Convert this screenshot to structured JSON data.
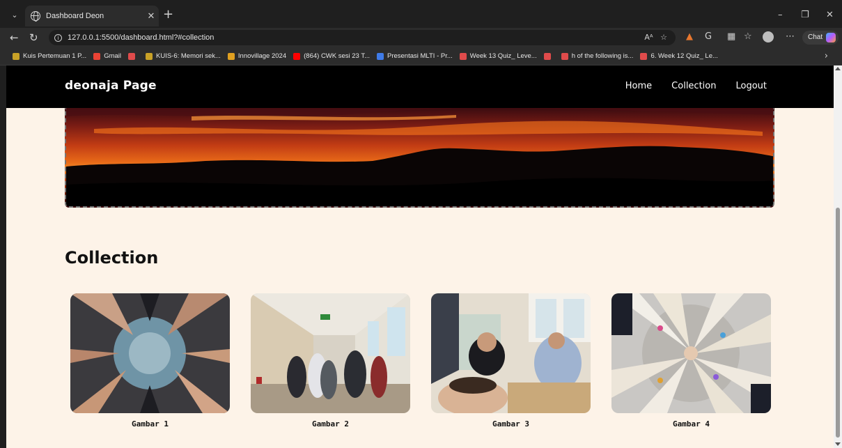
{
  "browser": {
    "tab_title": "Dashboard Deon",
    "url": "127.0.0.1:5500/dashboard.html?#collection",
    "chat_label": "Chat",
    "reader_label": "Aᴬ",
    "bookmarks": [
      {
        "label": "Kuis Pertemuan 1 P...",
        "color": "#c9a227"
      },
      {
        "label": "Gmail",
        "color": "#ea4335"
      },
      {
        "label": "",
        "color": "#e04b4b"
      },
      {
        "label": "KUIS-6: Memori sek...",
        "color": "#c9a227"
      },
      {
        "label": "Innovillage 2024",
        "color": "#e0a020"
      },
      {
        "label": "(864) CWK sesi 23 T...",
        "color": "#ff0000"
      },
      {
        "label": "Presentasi MLTI - Pr...",
        "color": "#3f7be8"
      },
      {
        "label": "Week 13 Quiz_ Leve...",
        "color": "#e04b4b"
      },
      {
        "label": "",
        "color": "#e04b4b"
      },
      {
        "label": "h of the following is...",
        "color": "#e04b4b"
      },
      {
        "label": "6. Week 12 Quiz_ Le...",
        "color": "#e04b4b"
      }
    ]
  },
  "site": {
    "brand": "deonaja Page",
    "nav": [
      "Home",
      "Collection",
      "Logout"
    ],
    "section_title": "Collection",
    "gallery": [
      {
        "caption": "Gambar 1"
      },
      {
        "caption": "Gambar 2"
      },
      {
        "caption": "Gambar 3"
      },
      {
        "caption": "Gambar 4"
      }
    ]
  },
  "colors": {
    "page_bg": "#fdf3e8",
    "nav_bg": "#000000",
    "nav_text": "#ffffff"
  }
}
